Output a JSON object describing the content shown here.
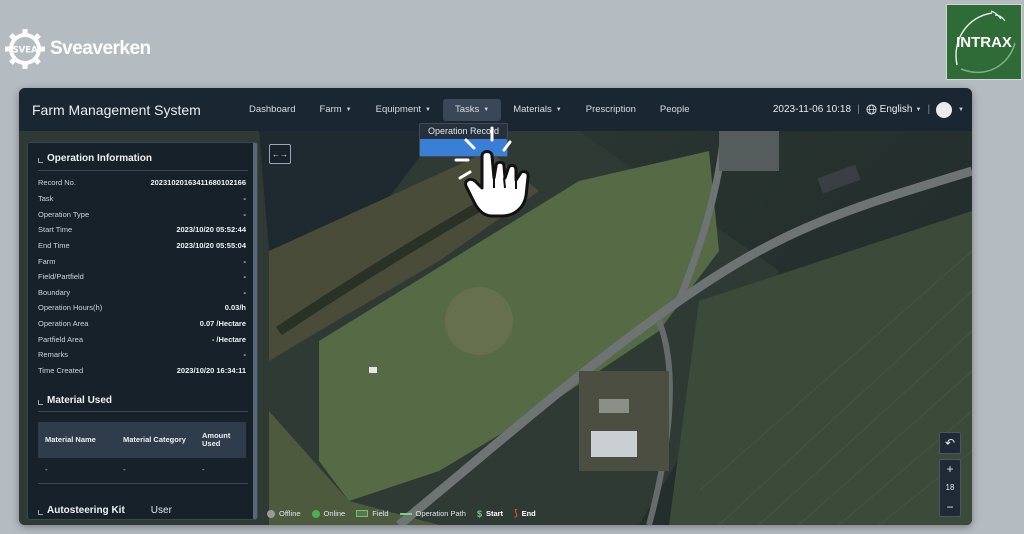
{
  "logos": {
    "left_brand": "Sveaverken",
    "left_gear_text": "SVEA",
    "right_brand": "INTRAX"
  },
  "app": {
    "title": "Farm Management System",
    "nav": [
      {
        "label": "Dashboard",
        "has_caret": false
      },
      {
        "label": "Farm",
        "has_caret": true
      },
      {
        "label": "Equipment",
        "has_caret": true
      },
      {
        "label": "Tasks",
        "has_caret": true,
        "active": true
      },
      {
        "label": "Materials",
        "has_caret": true
      },
      {
        "label": "Prescription",
        "has_caret": false
      },
      {
        "label": "People",
        "has_caret": false
      }
    ],
    "datetime": "2023-11-06 10:18",
    "language": "English",
    "accent_color": "#3a7fd6"
  },
  "tasks_dropdown": {
    "items": [
      "Operation Record",
      ""
    ]
  },
  "operation_info": {
    "heading": "Operation Information",
    "rows": [
      {
        "label": "Record No.",
        "value": "2023102016341168010216​6"
      },
      {
        "label": "Task",
        "value": "-"
      },
      {
        "label": "Operation Type",
        "value": "-"
      },
      {
        "label": "Start Time",
        "value": "2023/10/20 05:52:44"
      },
      {
        "label": "End Time",
        "value": "2023/10/20 05:55:04"
      },
      {
        "label": "Farm",
        "value": "-"
      },
      {
        "label": "Field/Partfield",
        "value": "-"
      },
      {
        "label": "Boundary",
        "value": "-"
      },
      {
        "label": "Operation Hours(h)",
        "value": "0.03/h"
      },
      {
        "label": "Operation Area",
        "value": "0.07 /Hectare"
      },
      {
        "label": "Partfield Area",
        "value": "- /Hectare"
      },
      {
        "label": "Remarks",
        "value": "-"
      },
      {
        "label": "Time Created",
        "value": "2023/10/20 16:34:11"
      }
    ]
  },
  "material_used": {
    "heading": "Material Used",
    "columns": [
      "Material Name",
      "Material Category",
      "Amount Used"
    ],
    "rows": [
      [
        "-",
        "-",
        "-"
      ]
    ]
  },
  "autosteering": {
    "heading": "Autosteering Kit",
    "user_label": "User"
  },
  "legend": [
    {
      "label": "Offline",
      "type": "dot",
      "color": "#9a9a9a"
    },
    {
      "label": "Online",
      "type": "dot",
      "color": "#4caf50"
    },
    {
      "label": "Field",
      "type": "swatch",
      "color": "#6fc06f"
    },
    {
      "label": "Operation Path",
      "type": "line",
      "color": "#7ad17a"
    },
    {
      "label": "Start",
      "type": "start",
      "color": "#6fd06f"
    },
    {
      "label": "End",
      "type": "end",
      "color": "#e04848"
    }
  ],
  "map_controls": {
    "zoom_level": "18",
    "zoom_in": "+",
    "zoom_out": "−",
    "undo_icon": "undo-icon"
  },
  "expand_icon": "expand-horizontal-icon"
}
